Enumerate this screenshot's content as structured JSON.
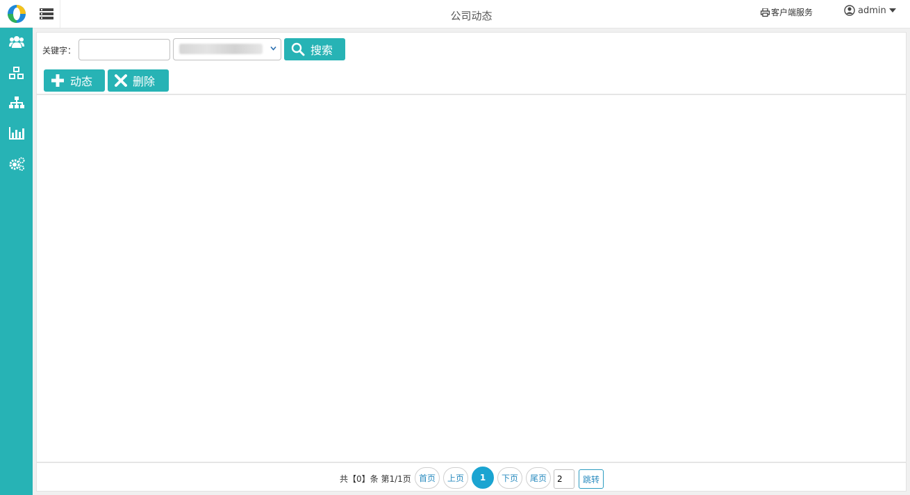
{
  "header": {
    "title": "公司动态",
    "client_service": "客户端服务",
    "user": "admin"
  },
  "sidebar": {
    "icons": [
      "users-icon",
      "cubes-icon",
      "sitemap-icon",
      "bar-chart-icon",
      "gears-icon"
    ]
  },
  "toolbar": {
    "keyword_label": "关键字：",
    "keyword_value": "",
    "search_label": "搜索",
    "add_label": "动态",
    "delete_label": "删除"
  },
  "pager": {
    "summary": "共【0】条 第1/1页",
    "first": "首页",
    "prev": "上页",
    "current": "1",
    "next": "下页",
    "last": "尾页",
    "jump_value": "2",
    "jump_label": "跳转"
  },
  "colors": {
    "accent": "#27b3b5",
    "pager_active": "#1ba4d1",
    "link": "#2a8bbf"
  }
}
